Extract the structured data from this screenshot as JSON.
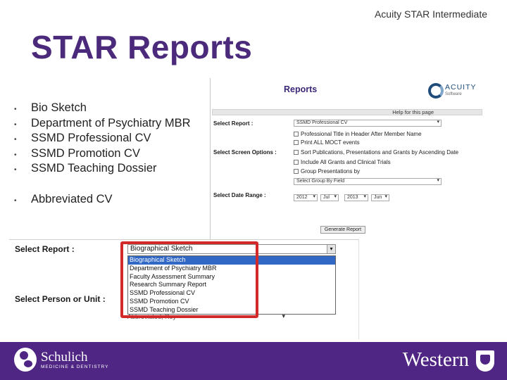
{
  "header": {
    "tag": "Acuity STAR Intermediate",
    "title": "STAR Reports"
  },
  "bullets": [
    "Bio Sketch",
    "Department of Psychiatry MBR",
    "SSMD Professional CV",
    "SSMD Promotion CV",
    "SSMD Teaching Dossier",
    "Abbreviated CV"
  ],
  "reports_screen": {
    "title": "Reports",
    "logo_text": "ACUITY",
    "logo_sub": "Software",
    "help_link": "Help for this page",
    "select_report_label": "Select Report :",
    "select_report_value": "SSMD Professional CV",
    "select_screen_options_label": "Select Screen Options :",
    "options": [
      "Professional Title in Header After Member Name",
      "Print ALL MOCT events",
      "Sort Publications, Presentations and Grants by Ascending Date",
      "Include All Grants and Clinical Trials",
      "Group Presentations by"
    ],
    "group_select_value": "Select Group By Field",
    "select_date_range_label": "Select Date Range :",
    "date_range": [
      "2012",
      "Jul",
      "2013",
      "Jun"
    ],
    "generate_button": "Generate Report"
  },
  "select_screen": {
    "select_report_label": "Select Report :",
    "select_value": "Biographical Sketch",
    "options": [
      "Biographical Sketch",
      "Department of Psychiatry MBR",
      "Faculty Assessment Summary",
      "Research Summary Report",
      "SSMD Professional CV",
      "SSMD Promotion CV",
      "SSMD Teaching Dossier"
    ],
    "highlighted_index": 0,
    "person_label": "Select Person or Unit :",
    "person_value": "Abbreviated, Roy"
  },
  "footer": {
    "school_name": "Schulich",
    "school_sub": "MEDICINE & DENTISTRY",
    "university": "Western"
  },
  "colors": {
    "brand_purple": "#4f2683",
    "title_purple": "#4b2a7b",
    "highlight_red": "#d22a2a",
    "selection_blue": "#3168c6"
  }
}
